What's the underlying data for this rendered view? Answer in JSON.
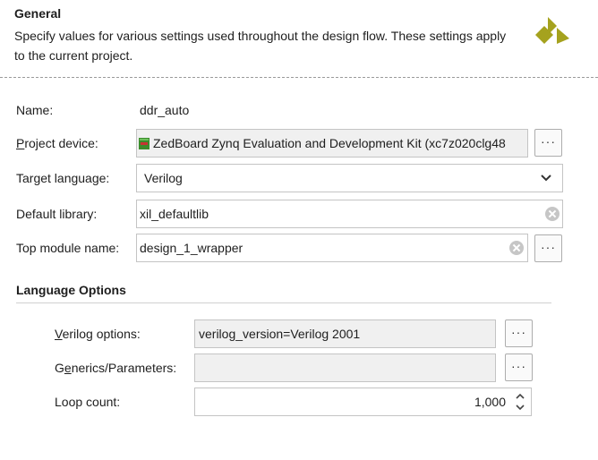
{
  "header": {
    "title": "General",
    "description": "Specify values for various settings used throughout the design flow. These settings apply to the current project."
  },
  "fields": {
    "name": {
      "label": "Name:",
      "value": "ddr_auto"
    },
    "project_device": {
      "label": "Project device:",
      "value": "ZedBoard Zynq Evaluation and Development Kit (xc7z020clg48"
    },
    "target_language": {
      "label": "Target language:",
      "value": "Verilog"
    },
    "default_library": {
      "label": "Default library:",
      "value": "xil_defaultlib"
    },
    "top_module": {
      "label": "Top module name:",
      "value": "design_1_wrapper"
    }
  },
  "language_options": {
    "title": "Language Options",
    "verilog_options": {
      "label": "Verilog options:",
      "value": "verilog_version=Verilog 2001"
    },
    "generics": {
      "label": "Generics/Parameters:",
      "value": ""
    },
    "loop_count": {
      "label": "Loop count:",
      "value": "1,000"
    }
  },
  "browse_label": "···",
  "icons": {
    "logo": "xilinx-logo-icon",
    "board": "board-icon",
    "dropdown": "chevron-down-icon",
    "clear": "clear-icon",
    "spin_up": "spin-up-icon",
    "spin_down": "spin-down-icon"
  },
  "colors": {
    "logo": "#a5a21e",
    "board_green": "#3c8c2c",
    "board_red": "#c83232"
  }
}
